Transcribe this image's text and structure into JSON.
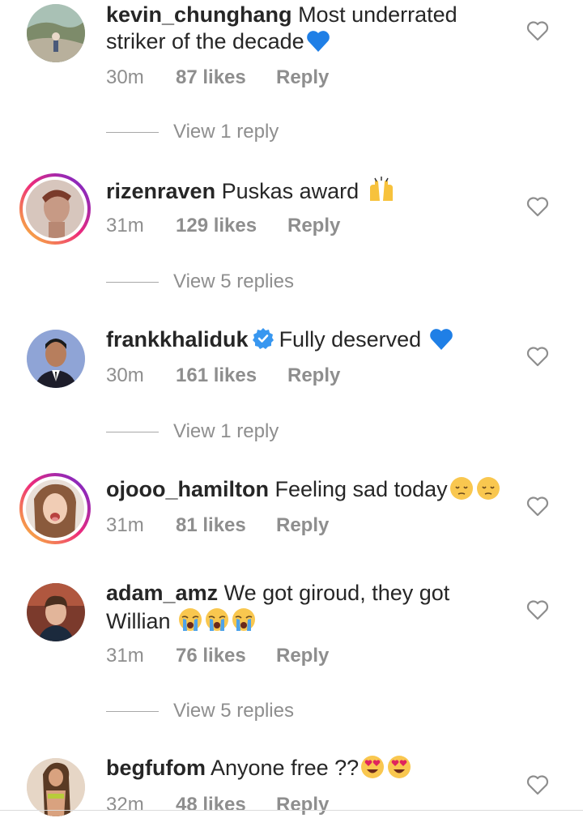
{
  "comments": [
    {
      "username": "kevin_chunghang",
      "text": "Most underrated striker of the decade",
      "emoji": "blue-heart",
      "time": "30m",
      "likes": "87 likes",
      "reply": "Reply"
    },
    {
      "username": "rizenraven",
      "text": "Puskas award",
      "emoji": "raising-hands",
      "time": "31m",
      "likes": "129 likes",
      "reply": "Reply"
    },
    {
      "username": "frankkhaliduk",
      "verified": true,
      "text": "Fully deserved",
      "emoji": "blue-heart",
      "time": "30m",
      "likes": "161 likes",
      "reply": "Reply"
    },
    {
      "username": "ojooo_hamilton",
      "text": "Feeling sad today",
      "emoji": "pensive-face x2",
      "time": "31m",
      "likes": "81 likes",
      "reply": "Reply"
    },
    {
      "username": "adam_amz",
      "text": "We got giroud, they got Willian",
      "emoji": "loudly-crying-face x3",
      "time": "31m",
      "likes": "76 likes",
      "reply": "Reply"
    },
    {
      "username": "begfufom",
      "text": "Anyone free ??",
      "emoji": "heart-eyes x2",
      "time": "32m",
      "likes": "48 likes",
      "reply": "Reply"
    }
  ],
  "view_replies": [
    "View 1 reply",
    "View 5 replies",
    "View 1 reply",
    "View 5 replies"
  ],
  "colors": {
    "text": "#262626",
    "muted": "#8e8e8e",
    "verified": "#3897f0",
    "heart_blue": "#1f7fe6"
  }
}
